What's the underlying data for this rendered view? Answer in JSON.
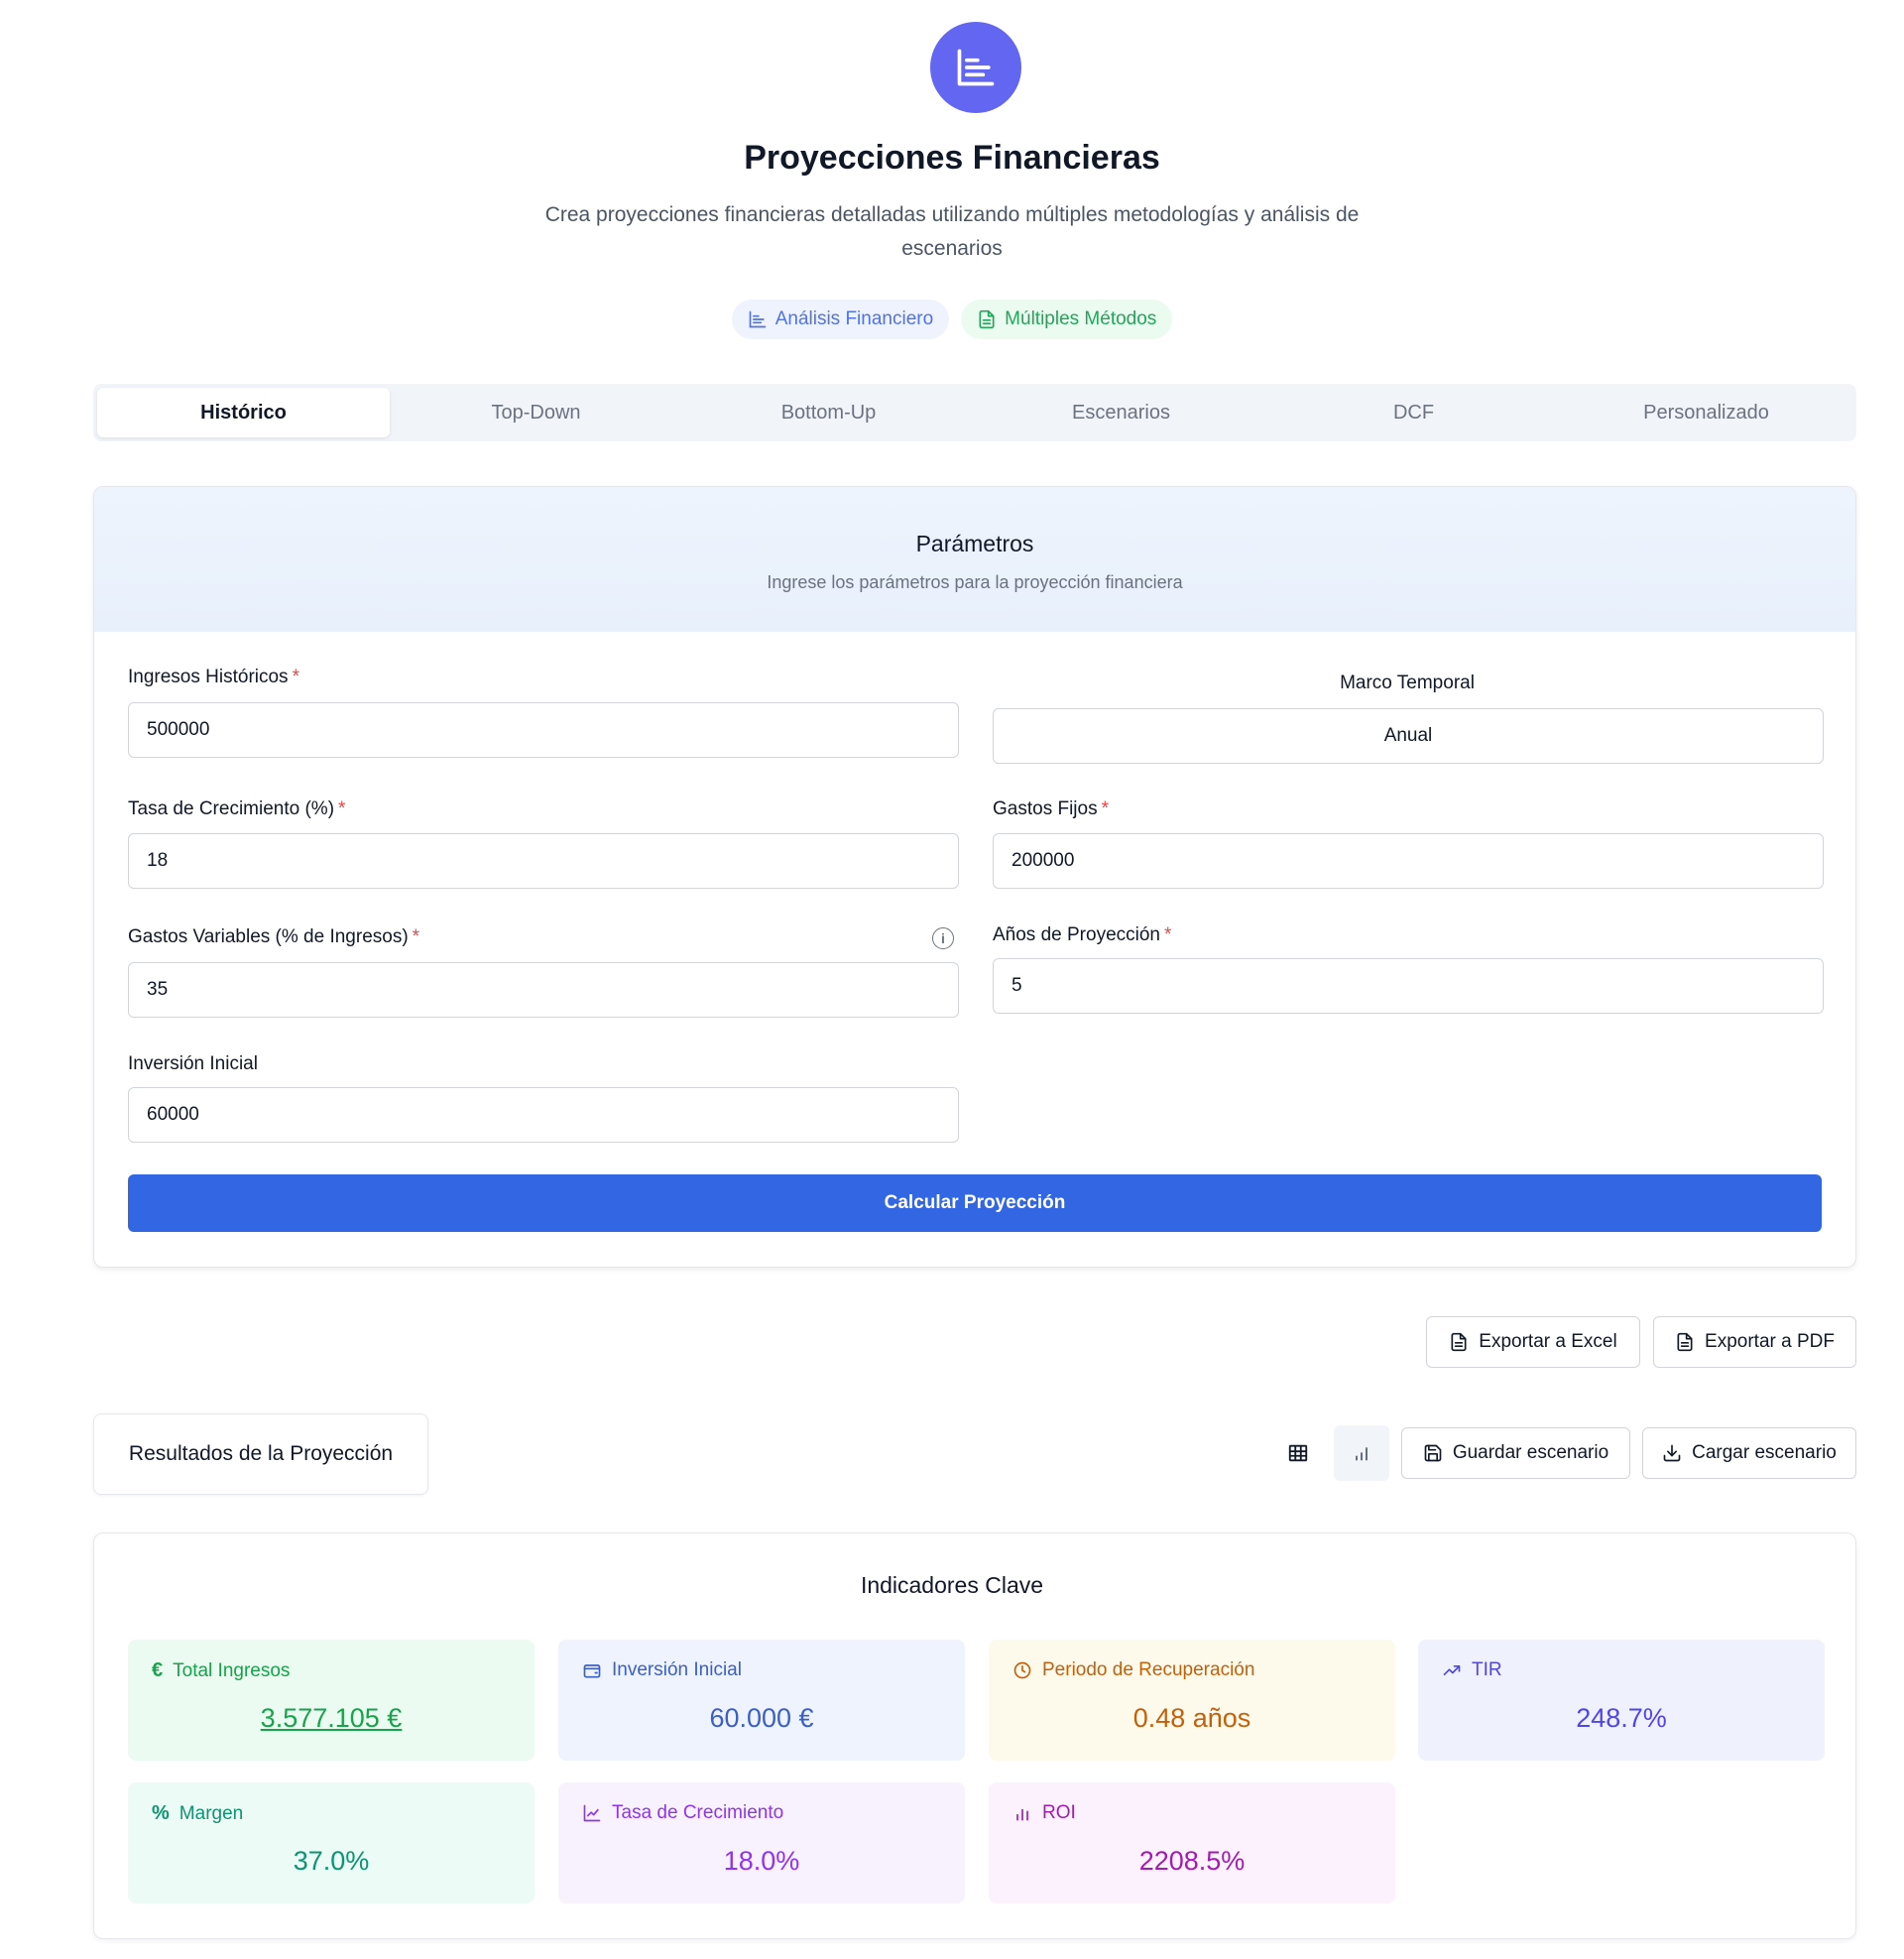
{
  "header": {
    "title": "Proyecciones Financieras",
    "subtitle": "Crea proyecciones financieras detalladas utilizando múltiples metodologías y análisis de escenarios",
    "badges": [
      {
        "label": "Análisis Financiero",
        "icon": "chart-icon"
      },
      {
        "label": "Múltiples Métodos",
        "icon": "document-icon"
      }
    ]
  },
  "tabs": [
    "Histórico",
    "Top-Down",
    "Bottom-Up",
    "Escenarios",
    "DCF",
    "Personalizado"
  ],
  "active_tab": "Histórico",
  "params": {
    "title": "Parámetros",
    "description": "Ingrese los parámetros para la proyección financiera",
    "ingresos_label": "Ingresos Históricos",
    "ingresos_value": "500000",
    "marco_label": "Marco Temporal",
    "marco_value": "Anual",
    "tasa_label": "Tasa de Crecimiento (%)",
    "tasa_value": "18",
    "fijos_label": "Gastos Fijos",
    "fijos_value": "200000",
    "variables_label": "Gastos Variables (% de Ingresos)",
    "variables_value": "35",
    "anios_label": "Años de Proyección",
    "anios_value": "5",
    "inversion_label": "Inversión Inicial",
    "inversion_value": "60000",
    "required_mark": "*",
    "calc_button": "Calcular Proyección"
  },
  "export": {
    "excel": "Exportar a Excel",
    "pdf": "Exportar a PDF"
  },
  "results": {
    "label": "Resultados de la Proyección",
    "save": "Guardar escenario",
    "load": "Cargar escenario"
  },
  "kpis": {
    "title": "Indicadores Clave",
    "items": [
      {
        "label": "Total Ingresos",
        "value": "3.577.105 €",
        "icon": "euro-icon",
        "color": "#16a34a",
        "bg": "#ecfbf1"
      },
      {
        "label": "Inversión Inicial",
        "value": "60.000 €",
        "icon": "wallet-icon",
        "color": "#3b5fc4",
        "bg": "#eef3fd"
      },
      {
        "label": "Periodo de Recuperación",
        "value": "0.48 años",
        "icon": "clock-icon",
        "color": "#c2610c",
        "bg": "#fefaeb"
      },
      {
        "label": "TIR",
        "value": "248.7%",
        "icon": "trending-up-icon",
        "color": "#4f46e5",
        "bg": "#eff1fd"
      },
      {
        "label": "Margen",
        "value": "37.0%",
        "icon": "percent-icon",
        "color": "#0d9470",
        "bg": "#edfbf6"
      },
      {
        "label": "Tasa de Crecimiento",
        "value": "18.0%",
        "icon": "line-chart-icon",
        "color": "#9333ea",
        "bg": "#f7f2fe"
      },
      {
        "label": "ROI",
        "value": "2208.5%",
        "icon": "bar-chart-icon",
        "color": "#a21caf",
        "bg": "#fcf2fd"
      }
    ]
  }
}
